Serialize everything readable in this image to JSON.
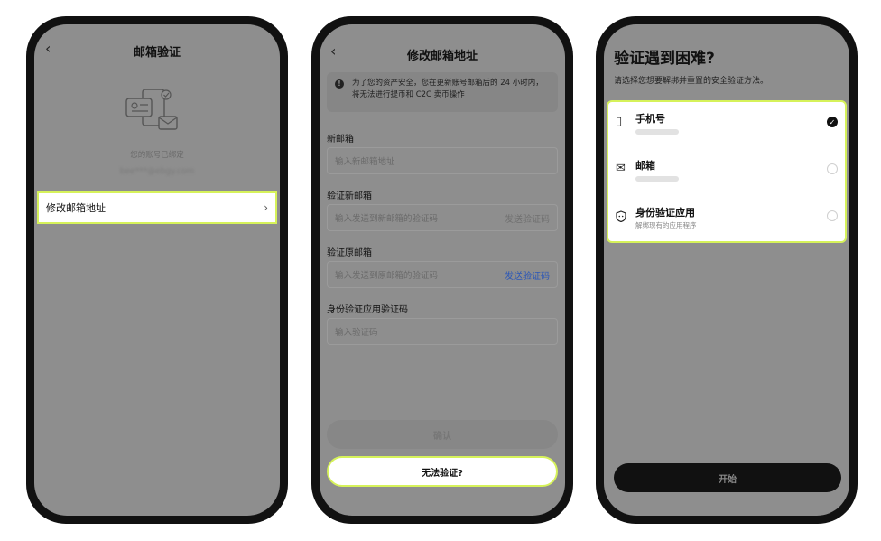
{
  "screen1": {
    "title": "邮箱验证",
    "bound_label": "您的账号已绑定",
    "email_masked": "bee***@ebgy.com",
    "row_label": "修改邮箱地址"
  },
  "screen2": {
    "title": "修改邮箱地址",
    "notice": "为了您的资产安全，您在更新账号邮箱后的 24 小时内，将无法进行提币和 C2C 卖币操作",
    "fields": [
      {
        "label": "新邮箱",
        "placeholder": "输入新邮箱地址",
        "action": ""
      },
      {
        "label": "验证新邮箱",
        "placeholder": "输入发送到新邮箱的验证码",
        "action": "发送验证码"
      },
      {
        "label": "验证原邮箱",
        "placeholder": "输入发送到原邮箱的验证码",
        "action": "发送验证码"
      },
      {
        "label": "身份验证应用验证码",
        "placeholder": "输入验证码",
        "action": ""
      }
    ],
    "confirm": "确认",
    "cant_verify": "无法验证?"
  },
  "screen3": {
    "title": "验证遇到困难?",
    "subtitle": "请选择您想要解绑并重置的安全验证方法。",
    "options": [
      {
        "name": "手机号",
        "sub": "",
        "icon": "phone-icon",
        "checked": true
      },
      {
        "name": "邮箱",
        "sub": "",
        "icon": "mail-icon",
        "checked": false
      },
      {
        "name": "身份验证应用",
        "sub": "解绑现有的应用程序",
        "icon": "shield-icon",
        "checked": false
      }
    ],
    "start": "开始"
  },
  "colors": {
    "highlight": "#d6f25a",
    "link": "#2a56b8",
    "overlay": "#8e8e8e"
  }
}
